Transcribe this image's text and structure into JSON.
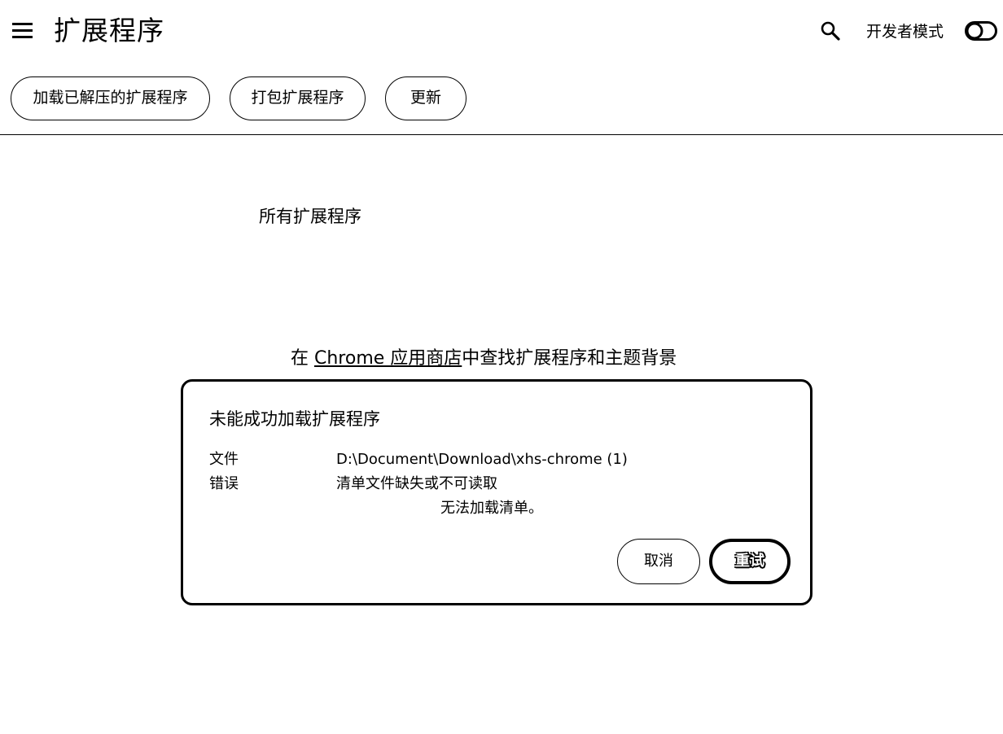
{
  "header": {
    "menu_icon": "hamburger-menu-icon",
    "title": "扩展程序",
    "search_icon": "search-icon",
    "developer_mode_label": "开发者模式",
    "developer_mode_toggle": "off"
  },
  "toolbar": {
    "load_unpacked_label": "加载已解压的扩展程序",
    "pack_label": "打包扩展程序",
    "update_label": "更新"
  },
  "main": {
    "section_title": "所有扩展程序",
    "store_prefix": "在 ",
    "store_link": "Chrome 应用商店",
    "store_suffix": "中查找扩展程序和主题背景"
  },
  "dialog": {
    "title": "未能成功加载扩展程序",
    "file_label": "文件",
    "file_value": "D:\\Document\\Download\\xhs-chrome (1)",
    "error_label": "错误",
    "error_value": "清单文件缺失或不可读取",
    "error_detail": "无法加载清单。",
    "cancel_label": "取消",
    "retry_label": "重试"
  },
  "colors": {
    "background": "#ffffff",
    "foreground": "#000000"
  }
}
